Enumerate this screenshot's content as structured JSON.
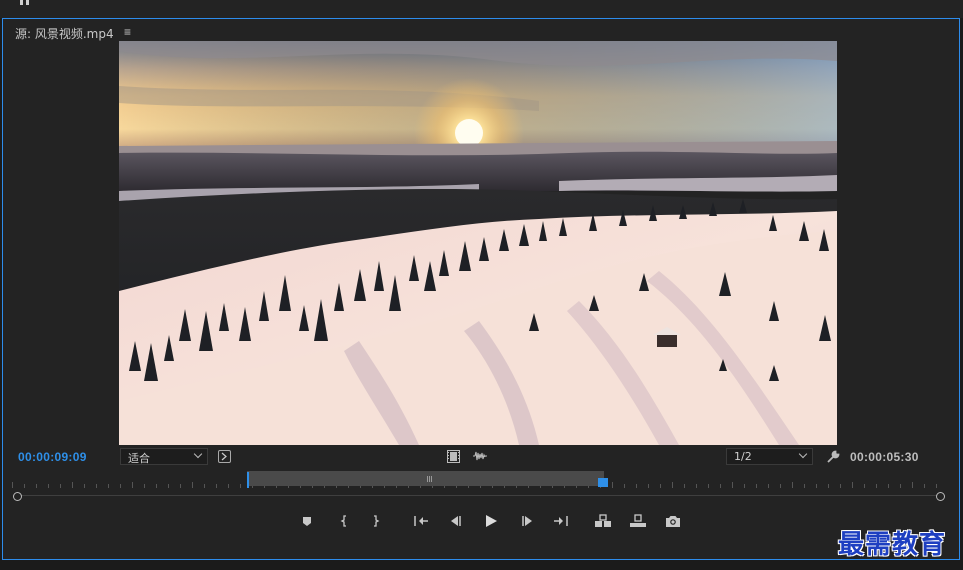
{
  "panel": {
    "title": "源: 风景视频.mp4",
    "menu_icon": "hamburger-menu-icon",
    "menu_glyph": "≡"
  },
  "playback": {
    "current_timecode": "00:00:09:09",
    "duration_timecode": "00:00:05:30",
    "zoom_selected": "适合",
    "resolution_selected": "1/2"
  },
  "timeline": {
    "playhead_fraction": 0.257,
    "in_point_fraction": 0.255,
    "out_point_fraction": 0.633
  },
  "transport": {
    "buttons": [
      {
        "name": "add-marker-icon"
      },
      {
        "name": "mark-in-icon"
      },
      {
        "name": "mark-out-icon"
      },
      {
        "name": "go-to-in-icon"
      },
      {
        "name": "step-back-icon"
      },
      {
        "name": "play-icon"
      },
      {
        "name": "step-forward-icon"
      },
      {
        "name": "go-to-out-icon"
      },
      {
        "name": "insert-icon"
      },
      {
        "name": "overwrite-icon"
      },
      {
        "name": "export-frame-icon"
      }
    ]
  },
  "colors": {
    "accent": "#2e8fe8",
    "panel_border": "#2d8ceb",
    "background": "#232323"
  },
  "watermark": {
    "text": "最需教育"
  }
}
